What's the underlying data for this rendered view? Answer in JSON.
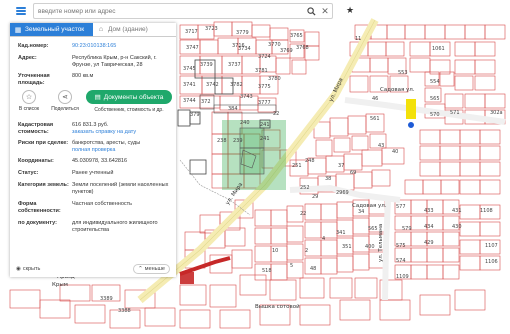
{
  "search": {
    "placeholder": "введите номер или адрес"
  },
  "icons": {
    "menu": "hamburger-icon",
    "search": "search-icon",
    "clear": "close-icon",
    "favorite": "star-icon",
    "parcel_tab": "land-icon",
    "building_tab": "house-icon",
    "bookmark": "star-icon",
    "share": "share-icon",
    "docs": "document-icon"
  },
  "colors": {
    "accent": "#2c7fd8",
    "docs_button": "#1fa86b",
    "parcel_highlight": "#2ea84a",
    "location": "#1e5bd6",
    "red_rail": "#c62828",
    "parcel_line": "#d32f2f"
  },
  "tabs": [
    {
      "label": "Земельный участок"
    },
    {
      "label": "Дом (здание)"
    }
  ],
  "fields": {
    "cad_number": {
      "label": "Кад.номер:",
      "value": "90:23:010138:165"
    },
    "address": {
      "label": "Адрес:",
      "value": "Республика Крым, р-н Сакский, г. Фрунзе, ул Таврическая, 28"
    },
    "area": {
      "label": "Уточненная площадь:",
      "value": "800 кв.м"
    }
  },
  "actions": {
    "bookmark_label": "В список",
    "share_label": "Поделиться",
    "docs_label": "Документы объекта",
    "docs_sub": "Собственник, стоимость и др."
  },
  "details": [
    {
      "label": "Кадастровая стоимость:",
      "value": "616 831.3 руб.",
      "link": "заказать справку на дату"
    },
    {
      "label": "Риски при сделке:",
      "value": "банкротства, аресты, суды",
      "link": "полная проверка"
    },
    {
      "label": "Координаты:",
      "value": "45.030978, 33.642816",
      "link": ""
    },
    {
      "label": "Статус:",
      "value": "Ранее учтенный",
      "link": ""
    },
    {
      "label": "Категория земель:",
      "value": "Земли поселений (земли населенных пунктов)",
      "link": ""
    },
    {
      "label": "Форма собственности:",
      "value": "Частная собственность",
      "link": ""
    },
    {
      "label": "по документу:",
      "value": "для индивидуального жилищного строительства",
      "link": ""
    }
  ],
  "bottom": {
    "hide_label": "скрыть",
    "less_label": "меньше"
  },
  "map": {
    "streets": [
      {
        "name": "ул. Мира"
      },
      {
        "name": "ул. Мира"
      },
      {
        "name": "Садовая ул."
      },
      {
        "name": "Садовая ул."
      },
      {
        "name": "ул. Тельмана"
      },
      {
        "name": "Вышка сотовой"
      },
      {
        "name": "Празд"
      },
      {
        "name": "Крым"
      }
    ],
    "parcel_numbers": [
      "3717",
      "3723",
      "3716",
      "3724",
      "3747",
      "3739",
      "3734",
      "3745",
      "3737",
      "3781",
      "3741",
      "3775",
      "3742",
      "3782",
      "3743",
      "3777",
      "3744",
      "3769",
      "3770",
      "3768",
      "3765",
      "3780",
      "3779",
      "11",
      "1061",
      "553",
      "554",
      "46",
      "565",
      "302а",
      "570",
      "571",
      "561",
      "43",
      "22",
      "40",
      "372",
      "384",
      "379",
      "240",
      "241",
      "241",
      "239",
      "238",
      "22",
      "248",
      "251",
      "252",
      "37",
      "38",
      "69",
      "29",
      "2969",
      "34",
      "565",
      "351",
      "341",
      "400",
      "431",
      "430",
      "434",
      "433",
      "429",
      "1108",
      "1107",
      "1106",
      "579",
      "577",
      "575",
      "574",
      "1109",
      "518",
      "3389",
      "3388",
      "5",
      "10",
      "2",
      "4",
      "22",
      "48"
    ]
  }
}
